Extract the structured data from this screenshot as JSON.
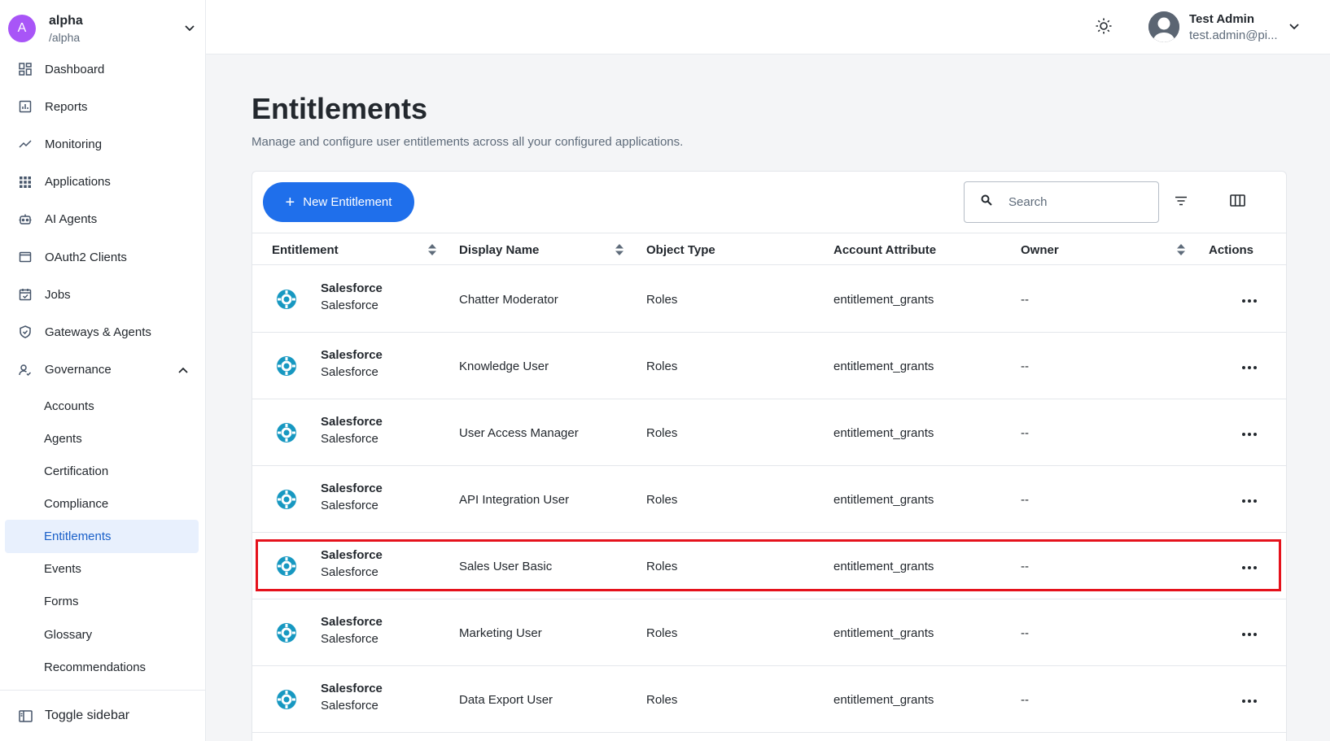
{
  "realm": {
    "initial": "A",
    "name": "alpha",
    "path": "/alpha"
  },
  "nav": {
    "dashboard": "Dashboard",
    "reports": "Reports",
    "monitoring": "Monitoring",
    "applications": "Applications",
    "ai_agents": "AI Agents",
    "oauth2": "OAuth2 Clients",
    "jobs": "Jobs",
    "gateways": "Gateways & Agents",
    "governance": "Governance",
    "governance_sub": [
      "Accounts",
      "Agents",
      "Certification",
      "Compliance",
      "Entitlements",
      "Events",
      "Forms",
      "Glossary",
      "Recommendations"
    ],
    "active_sub": "Entitlements",
    "toggle": "Toggle sidebar"
  },
  "user": {
    "name": "Test Admin",
    "email": "test.admin@pi..."
  },
  "page": {
    "title": "Entitlements",
    "subtitle": "Manage and configure user entitlements across all your configured applications."
  },
  "toolbar": {
    "new_label": "New Entitlement",
    "search_placeholder": "Search"
  },
  "table": {
    "headers": {
      "entitlement": "Entitlement",
      "display_name": "Display Name",
      "object_type": "Object Type",
      "account_attribute": "Account Attribute",
      "owner": "Owner",
      "actions": "Actions"
    },
    "rows": [
      {
        "app": "Salesforce",
        "app_sub": "Salesforce",
        "display_name": "Chatter Moderator",
        "object_type": "Roles",
        "account_attribute": "entitlement_grants",
        "owner": "--"
      },
      {
        "app": "Salesforce",
        "app_sub": "Salesforce",
        "display_name": "Knowledge User",
        "object_type": "Roles",
        "account_attribute": "entitlement_grants",
        "owner": "--"
      },
      {
        "app": "Salesforce",
        "app_sub": "Salesforce",
        "display_name": "User Access Manager",
        "object_type": "Roles",
        "account_attribute": "entitlement_grants",
        "owner": "--"
      },
      {
        "app": "Salesforce",
        "app_sub": "Salesforce",
        "display_name": "API Integration User",
        "object_type": "Roles",
        "account_attribute": "entitlement_grants",
        "owner": "--"
      },
      {
        "app": "Salesforce",
        "app_sub": "Salesforce",
        "display_name": "Sales User Basic",
        "object_type": "Roles",
        "account_attribute": "entitlement_grants",
        "owner": "--"
      },
      {
        "app": "Salesforce",
        "app_sub": "Salesforce",
        "display_name": "Marketing User",
        "object_type": "Roles",
        "account_attribute": "entitlement_grants",
        "owner": "--"
      },
      {
        "app": "Salesforce",
        "app_sub": "Salesforce",
        "display_name": "Data Export User",
        "object_type": "Roles",
        "account_attribute": "entitlement_grants",
        "owner": "--"
      }
    ]
  },
  "colors": {
    "primary": "#1f6feb",
    "highlight": "#e5121c",
    "salesforce": "#1798c1",
    "active_bg": "#e8f0fd"
  }
}
